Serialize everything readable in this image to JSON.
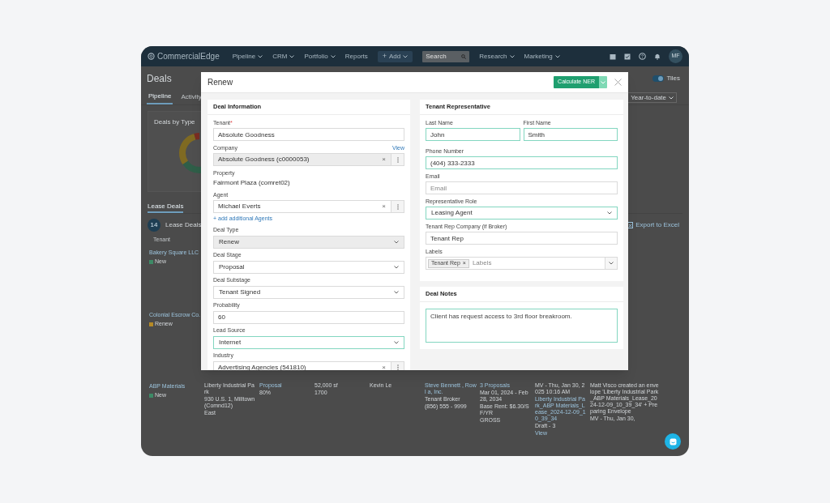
{
  "nav": {
    "logo": "CommercialEdge",
    "menu": [
      {
        "label": "Pipeline",
        "dropdown": true
      },
      {
        "label": "CRM",
        "dropdown": true
      },
      {
        "label": "Portfolio",
        "dropdown": true
      },
      {
        "label": "Reports",
        "dropdown": false
      }
    ],
    "add_button": {
      "icon": "+",
      "label": "Add"
    },
    "search": {
      "placeholder": "Search"
    },
    "menu_right": [
      {
        "label": "Research",
        "dropdown": true
      },
      {
        "label": "Marketing",
        "dropdown": true
      }
    ],
    "avatar": "MF"
  },
  "page": {
    "title": "Deals",
    "tabs": [
      {
        "label": "Pipeline",
        "selected": true
      },
      {
        "label": "Activity",
        "selected": false
      }
    ],
    "view_toggle": {
      "label": "Tiles",
      "on": true
    },
    "period": "Year-to-date",
    "chart_card": {
      "title": "Deals by Type"
    },
    "deal_tabs": [
      {
        "label": "Lease Deals",
        "selected": true
      }
    ],
    "count": "14",
    "count_label": "Lease Deals",
    "column_header": "Tenant",
    "export": "Export to Excel",
    "deals": [
      {
        "name": "Bakery Square LLC",
        "type": "New",
        "color": "#3d8a66"
      },
      {
        "name": "Colonial Escrow Co.",
        "type": "Renew",
        "color": "#b58a26"
      }
    ],
    "last_deal": {
      "name": "ABP Materials",
      "type": "New",
      "color": "#3d8a66",
      "cells": [
        [
          "Liberty Industrial Park",
          "930 U.S. 1, Milltown (Comnd12)",
          "East"
        ],
        [
          "Proposal",
          "80%"
        ],
        [
          "52,000 sf",
          "1700"
        ],
        [
          "Kevin Le"
        ],
        [
          "Steve Bennett , Rowl a, Inc.",
          "Tenant Broker",
          "(856) 555 - 9999"
        ],
        [
          "3 Proposals",
          "Mar 01, 2024 - Feb 28, 2034",
          "Base Rent: $6.30/SF/YR",
          "GROSS"
        ],
        [
          "MV - Thu, Jan 30, 2025 10:16 AM",
          "Liberty Industrial Park_ABP Materials_Lease_2024-12-09_10_39_34",
          "Draft - 3",
          "View"
        ],
        [
          "Matt Visco created an envelope 'Liberty Industrial Park_ABP Materials_Lease_2024-12-09_10_39_34' + Preparing Envelope",
          "MV - Thu, Jan 30,"
        ]
      ]
    }
  },
  "modal": {
    "title": "Renew",
    "primary_button": "Calculate NER",
    "left_card": {
      "title": "Deal Information",
      "fields": [
        {
          "kind": "text",
          "label": "Tenant",
          "required_mark": "*",
          "value": "Absolute Goodness",
          "disabled": false,
          "highlighted": false
        },
        {
          "kind": "combo",
          "label": "Company",
          "link": "View",
          "value": "Absolute Goodness (c0000053)",
          "clear": "×",
          "disabled": true,
          "highlighted": false
        },
        {
          "kind": "static",
          "label": "Property",
          "value": "Fairmont Plaza (comret02)"
        },
        {
          "kind": "combo",
          "label": "Agent",
          "value": "Michael Everts",
          "clear": "×",
          "add_link": "+ add additional Agents",
          "disabled": false,
          "highlighted": false
        },
        {
          "kind": "select",
          "label": "Deal Type",
          "value": "Renew",
          "disabled": true,
          "highlighted": false
        },
        {
          "kind": "select",
          "label": "Deal Stage",
          "value": "Proposal",
          "disabled": false,
          "highlighted": false
        },
        {
          "kind": "select",
          "label": "Deal Substage",
          "value": "Tenant Signed",
          "disabled": false,
          "highlighted": false
        },
        {
          "kind": "text",
          "label": "Probability",
          "value": "60",
          "disabled": false,
          "highlighted": false
        },
        {
          "kind": "select",
          "label": "Lead Source",
          "value": "Internet",
          "disabled": false,
          "highlighted": true
        },
        {
          "kind": "combo",
          "label": "Industry",
          "value": "Advertising Agencies (541810)",
          "clear": "×",
          "disabled": false,
          "highlighted": false
        }
      ]
    },
    "right_card": {
      "title": "Tenant Representative",
      "fields": [
        {
          "kind": "pair",
          "fields": [
            {
              "kind": "text",
              "label": "Last Name",
              "value": "John",
              "disabled": false,
              "highlighted": true
            },
            {
              "kind": "text",
              "label": "First Name",
              "value": "Smith",
              "disabled": false,
              "highlighted": true
            }
          ]
        },
        {
          "kind": "text",
          "label": "Phone Number",
          "value": "(404) 333-2333",
          "disabled": false,
          "highlighted": true
        },
        {
          "kind": "text",
          "label": "Email",
          "placeholder": "Email",
          "disabled": false,
          "highlighted": false
        },
        {
          "kind": "select",
          "label": "Representative Role",
          "value": "Leasing Agent",
          "disabled": false,
          "highlighted": true
        },
        {
          "kind": "text",
          "label": "Tenant Rep Company (if Broker)",
          "value": "Tenant Rep",
          "disabled": false,
          "highlighted": false
        },
        {
          "kind": "tags",
          "label": "Labels",
          "tags": [
            {
              "label": "Tenant Rep",
              "remove": "×"
            }
          ],
          "placeholder": "Labels"
        }
      ]
    },
    "notes_card": {
      "title": "Deal Notes",
      "value": "Client has request access to 3rd floor breakroom.",
      "highlighted": true
    }
  }
}
